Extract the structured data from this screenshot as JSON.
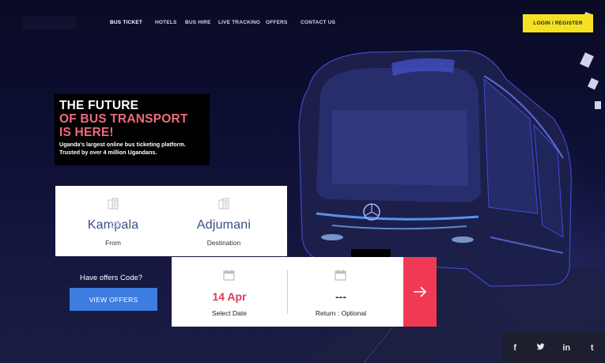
{
  "nav": {
    "items": [
      {
        "label": "BUS TICKET"
      },
      {
        "label": "HOTELS"
      },
      {
        "label": "BUS HIRE"
      },
      {
        "label": "LIVE TRACKING"
      },
      {
        "label": "OFFERS"
      },
      {
        "label": "CONTACT US"
      }
    ],
    "login_label": "LOGIN / REGISTER"
  },
  "hero": {
    "line1": "THE FUTURE",
    "line2": "OF BUS TRANSPORT",
    "line3": "IS HERE!",
    "sub1": "Uganda's largest online bus ticketing platform.",
    "sub2": "Trusted by over 4 million Ugandans."
  },
  "search": {
    "from_city": "Kampala",
    "from_label": "From",
    "to_city": "Adjumani",
    "to_label": "Destination",
    "date_value": "14 Apr",
    "date_label": "Select Date",
    "return_value": "---",
    "return_label": "Return : Optional"
  },
  "offers": {
    "question": "Have offers Code?",
    "button_label": "VIEW OFFERS"
  },
  "social": {
    "facebook": "f",
    "twitter": "t-bird",
    "linkedin": "in",
    "tumblr": "t"
  },
  "colors": {
    "accent_yellow": "#f4e222",
    "accent_red": "#f03a55",
    "headline_pink": "#ee6b7d",
    "offers_blue": "#3e7de0",
    "city_blue": "#3a4e86"
  },
  "icons": {
    "building": "building-icon",
    "swap": "swap-arrows-icon",
    "calendar": "calendar-icon",
    "arrow": "arrow-right-icon"
  }
}
